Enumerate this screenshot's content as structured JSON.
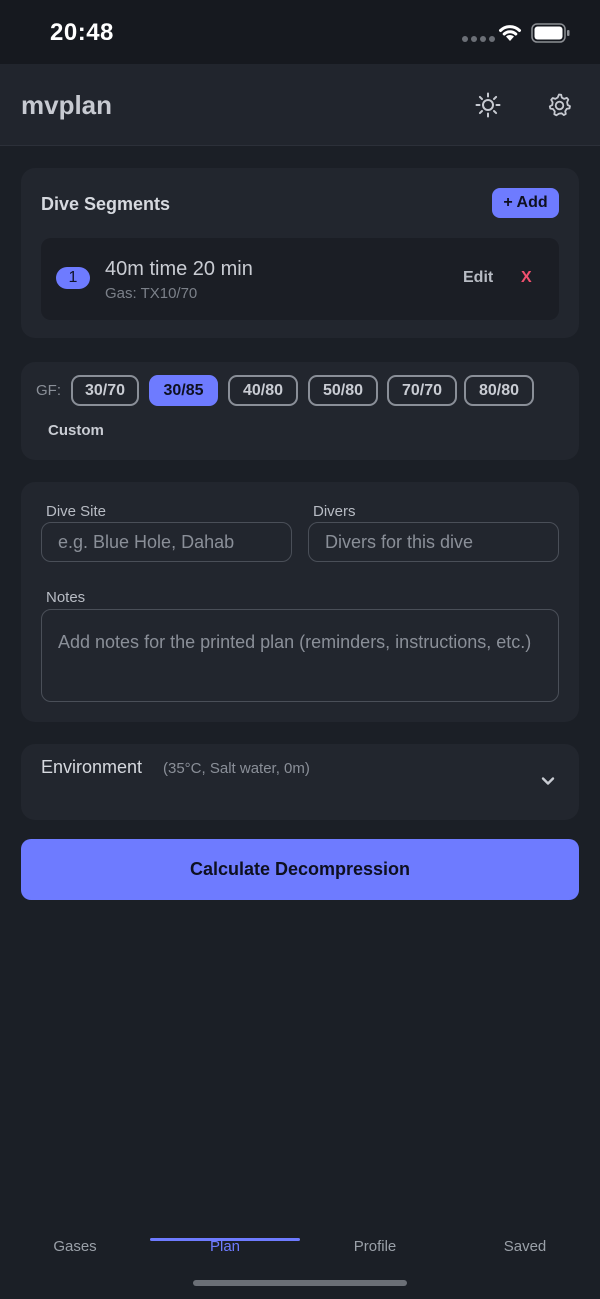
{
  "status_bar": {
    "time": "20:48"
  },
  "header": {
    "title": "mvplan",
    "theme_icon": "sun-icon",
    "settings_icon": "gear-icon"
  },
  "segments_card": {
    "title": "Dive Segments",
    "add_label": "+ Add",
    "segments": [
      {
        "number": "1",
        "title": "40m time 20 min",
        "gas": "Gas: TX10/70",
        "edit_label": "Edit",
        "delete_label": "X"
      }
    ]
  },
  "gf_card": {
    "label": "GF:",
    "options": [
      "30/70",
      "30/85",
      "40/80",
      "50/80",
      "70/70",
      "80/80"
    ],
    "selected": "30/85",
    "custom_label": "Custom"
  },
  "fields_card": {
    "dive_site": {
      "label": "Dive Site",
      "placeholder": "e.g. Blue Hole, Dahab",
      "value": ""
    },
    "divers": {
      "label": "Divers",
      "placeholder": "Divers for this dive",
      "value": ""
    },
    "notes": {
      "label": "Notes",
      "placeholder": "Add notes for the printed plan (reminders, instructions, etc.)",
      "value": ""
    }
  },
  "environment": {
    "title": "Environment",
    "summary": "(35°C, Salt water, 0m)",
    "icon": "chevron-down-icon"
  },
  "calculate_label": "Calculate Decompression",
  "tabs": [
    {
      "label": "Gases",
      "active": false
    },
    {
      "label": "Plan",
      "active": true
    },
    {
      "label": "Profile",
      "active": false
    },
    {
      "label": "Saved",
      "active": false
    }
  ],
  "colors": {
    "accent": "#6e7bff",
    "background": "#1b1f26",
    "card": "#22262e",
    "danger": "#f0506e"
  }
}
